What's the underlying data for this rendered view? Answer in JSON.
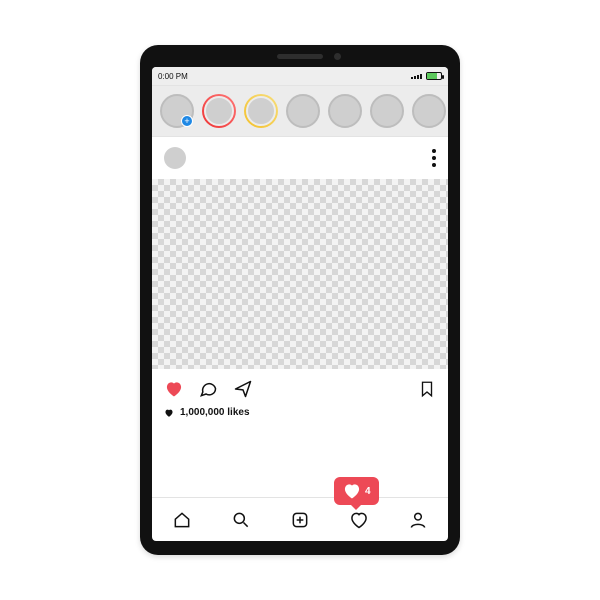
{
  "statusbar": {
    "time": "0:00 PM"
  },
  "stories": {
    "items": [
      {
        "name": "your-story",
        "add_badge": true
      },
      {
        "name": "story-2",
        "ring": "red"
      },
      {
        "name": "story-3",
        "ring": "yellow"
      },
      {
        "name": "story-4"
      },
      {
        "name": "story-5"
      },
      {
        "name": "story-6"
      },
      {
        "name": "story-7"
      }
    ]
  },
  "post": {
    "likes_text": "1,000,000  likes"
  },
  "notifications": {
    "like_count": "4"
  },
  "colors": {
    "heart": "#ed4956",
    "accent_blue": "#1e88e5"
  }
}
